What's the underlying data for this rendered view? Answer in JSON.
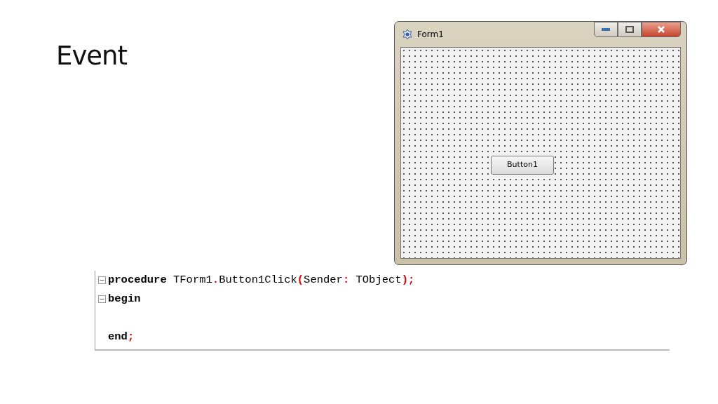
{
  "slide": {
    "title": "Event"
  },
  "form": {
    "title": "Form1",
    "button": "Button1"
  },
  "code": {
    "lines": [
      {
        "kind": "code",
        "fold": true,
        "tokens": [
          {
            "kind": "keyword",
            "text": "procedure"
          },
          {
            "kind": "plain",
            "text": " TForm1"
          },
          {
            "kind": "symbol",
            "text": "."
          },
          {
            "kind": "plain",
            "text": "Button1Click"
          },
          {
            "kind": "symbol",
            "text": "("
          },
          {
            "kind": "plain",
            "text": "Sender"
          },
          {
            "kind": "symbol",
            "text": ":"
          },
          {
            "kind": "plain",
            "text": " TObject"
          },
          {
            "kind": "symbol",
            "text": ");"
          }
        ]
      },
      {
        "kind": "code",
        "fold": true,
        "tokens": [
          {
            "kind": "keyword",
            "text": "begin"
          }
        ]
      },
      {
        "kind": "blank"
      },
      {
        "kind": "code",
        "fold": false,
        "tokens": [
          {
            "kind": "keyword",
            "text": "end"
          },
          {
            "kind": "symbol",
            "text": ";"
          }
        ]
      }
    ]
  }
}
